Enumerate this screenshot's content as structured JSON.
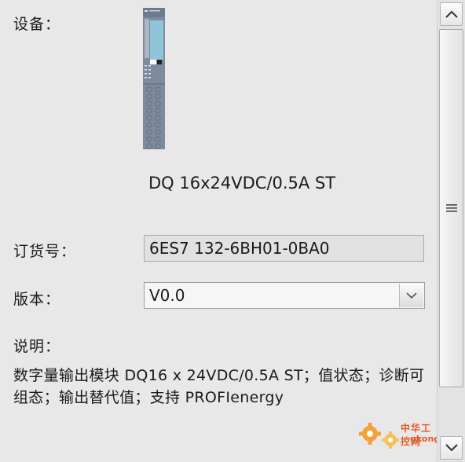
{
  "labels": {
    "device": "设备：",
    "order_number": "订货号：",
    "version": "版本：",
    "description": "说明："
  },
  "module": {
    "title": "DQ 16x24VDC/0.5A ST"
  },
  "order_number": {
    "value": "6ES7 132-6BH01-0BA0"
  },
  "version": {
    "value": "V0.0"
  },
  "description": {
    "text": "数字量输出模块 DQ16 x 24VDC/0.5A ST；值状态；诊断可组态；输出替代值；支持 PROFIenergy"
  },
  "watermark": {
    "line1": "中华工控网",
    "line2": "gkong.com"
  },
  "colors": {
    "background": "#e8e8e8",
    "field_bg": "#e1e1e1",
    "device_body": "#7e8b9e",
    "device_accent": "#8fc4d9",
    "watermark": "#e05b2c"
  },
  "icons": {
    "scroll_up": "chevron-up-icon",
    "scroll_down": "chevron-down-icon",
    "thumb_grip": "grip-icon",
    "dropdown": "triangle-down-icon",
    "watermark_logo": "gear-icon"
  }
}
